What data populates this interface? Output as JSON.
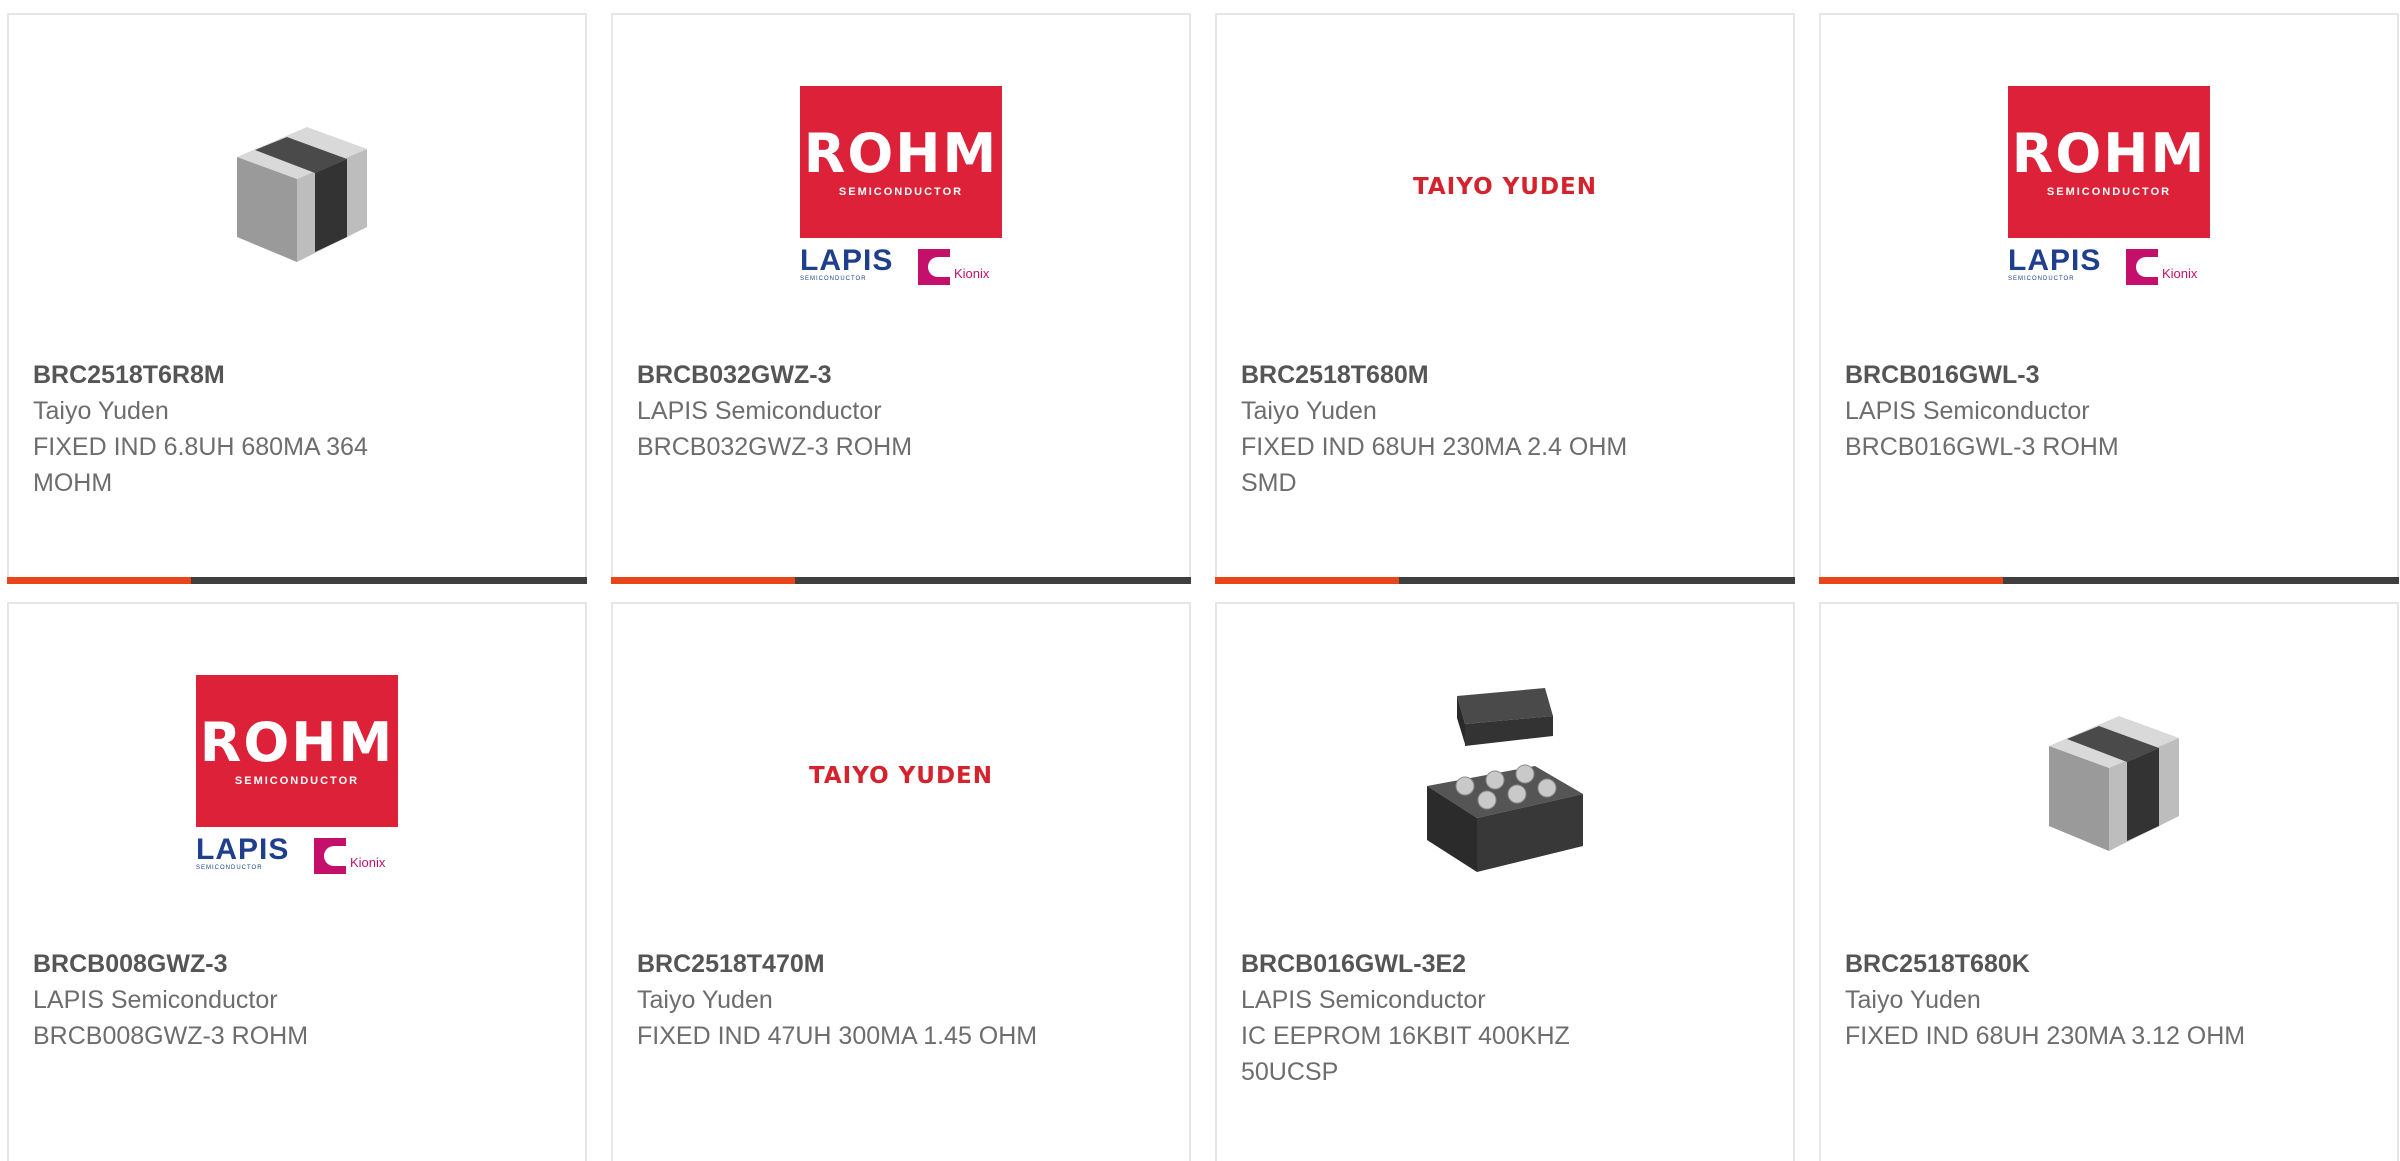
{
  "products": [
    {
      "part": "BRC2518T6R8M",
      "manufacturer": "Taiyo Yuden",
      "description": "FIXED IND 6.8UH 680MA 364 MOHM",
      "image": "inductor-chip-icon"
    },
    {
      "part": "BRCB032GWZ-3",
      "manufacturer": "LAPIS Semiconductor",
      "description": "BRCB032GWZ-3 ROHM",
      "image": "rohm-lapis-logo"
    },
    {
      "part": "BRC2518T680M",
      "manufacturer": "Taiyo Yuden",
      "description": "FIXED IND 68UH 230MA 2.4 OHM SMD",
      "image": "taiyo-yuden-logo"
    },
    {
      "part": "BRCB016GWL-3",
      "manufacturer": "LAPIS Semiconductor",
      "description": "BRCB016GWL-3 ROHM",
      "image": "rohm-lapis-logo"
    },
    {
      "part": "BRCB008GWZ-3",
      "manufacturer": "LAPIS Semiconductor",
      "description": "BRCB008GWZ-3 ROHM",
      "image": "rohm-lapis-logo"
    },
    {
      "part": "BRC2518T470M",
      "manufacturer": "Taiyo Yuden",
      "description": "FIXED IND 47UH 300MA 1.45 OHM",
      "image": "taiyo-yuden-logo"
    },
    {
      "part": "BRCB016GWL-3E2",
      "manufacturer": "LAPIS Semiconductor",
      "description": "IC EEPROM 16KBIT 400KHZ 50UCSP",
      "image": "ucsp-package-icon"
    },
    {
      "part": "BRC2518T680K",
      "manufacturer": "Taiyo Yuden",
      "description": "FIXED IND 68UH 230MA 3.12 OHM",
      "image": "inductor-chip-icon"
    }
  ],
  "logos": {
    "rohm_word": "ROHM",
    "rohm_sub": "SEMICONDUCTOR",
    "lapis_word": "LAPIS",
    "lapis_sub": "SEMICONDUCTOR",
    "kionix": "Kionix",
    "taiyo": "TAIYO YUDEN"
  },
  "colors": {
    "accent": "#e8461a",
    "bar": "#3f3f3f",
    "rohm_red": "#dc2139",
    "taiyo_red": "#d5232e"
  }
}
